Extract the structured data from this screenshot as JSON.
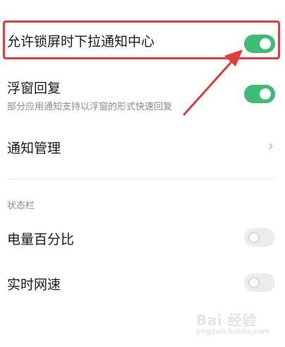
{
  "settings": {
    "lockscreen_pull": {
      "label": "允许锁屏时下拉通知中心",
      "enabled": true
    },
    "floating_reply": {
      "label": "浮窗回复",
      "description": "部分应用通知支持以浮窗的形式快速回复",
      "enabled": true
    },
    "notification_manage": {
      "label": "通知管理"
    },
    "statusbar_section": {
      "title": "状态栏"
    },
    "battery_percent": {
      "label": "电量百分比",
      "enabled": false
    },
    "realtime_speed": {
      "label": "实时网速",
      "enabled": false
    }
  },
  "watermark": {
    "text": "Bai 经验",
    "sub": "jingyan.baidu.com"
  },
  "colors": {
    "accent_green": "#3dbd73",
    "annotation_red": "#e53b3b"
  }
}
